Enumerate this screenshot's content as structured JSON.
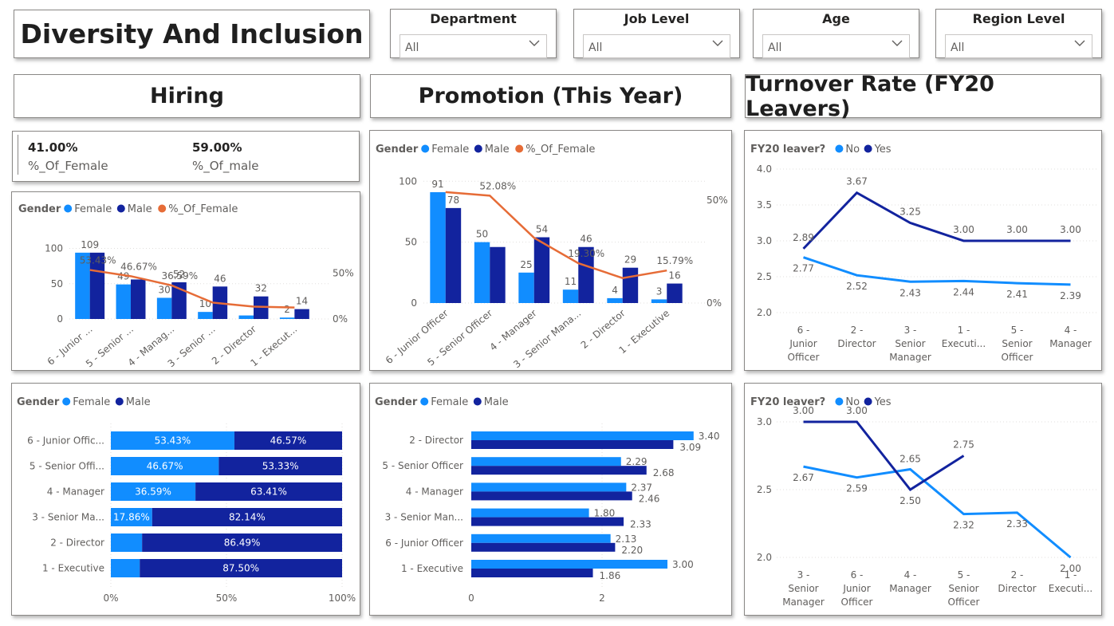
{
  "header": {
    "title": "Diversity And Inclusion"
  },
  "slicers": [
    {
      "label": "Department",
      "value": "All"
    },
    {
      "label": "Job Level",
      "value": "All"
    },
    {
      "label": "Age",
      "value": "All"
    },
    {
      "label": "Region Level",
      "value": "All"
    }
  ],
  "sections": {
    "hiring": "Hiring",
    "promotion": "Promotion (This Year)",
    "turnover": "Turnover Rate (FY20 Leavers)"
  },
  "kpi": {
    "female_value": "41.00%",
    "female_label": "%_Of_Female",
    "male_value": "59.00%",
    "male_label": "%_Of_male"
  },
  "colors": {
    "female": "#118dff",
    "male": "#12239e",
    "pct": "#e66c37",
    "border": "#8a8886"
  },
  "chart_data": [
    {
      "id": "hiring_combo",
      "type": "bar",
      "legend_title": "Gender",
      "series_names": [
        "Female",
        "Male",
        "%_Of_Female"
      ],
      "categories": [
        "6 - Junior ...",
        "5 - Senior ...",
        "4 - Manag...",
        "3 - Senior ...",
        "2 - Director",
        "1 - Execut..."
      ],
      "female": [
        94,
        49,
        30,
        10,
        5,
        2
      ],
      "male": [
        94,
        56,
        52,
        46,
        32,
        14
      ],
      "female_labels": [
        "",
        "49",
        "30",
        "10",
        "",
        "2"
      ],
      "male_labels": [
        "",
        "",
        "52",
        "46",
        "32",
        "14"
      ],
      "top_labels": [
        "109",
        "",
        "",
        "",
        "",
        ""
      ],
      "pct_of_female": [
        53.43,
        46.67,
        36.59,
        17.86,
        13.51,
        12.5
      ],
      "pct_labels": [
        "53.43%",
        "46.67%",
        "36.59%",
        "",
        "",
        ""
      ],
      "y_ticks": [
        "0",
        "50",
        "100"
      ],
      "y2_ticks": [
        "0%",
        "50%"
      ],
      "ylim": [
        0,
        130
      ],
      "y2lim": [
        0,
        100
      ]
    },
    {
      "id": "promotion_combo",
      "type": "bar",
      "legend_title": "Gender",
      "series_names": [
        "Female",
        "Male",
        "%_Of_Female"
      ],
      "categories": [
        "6 - Junior Officer",
        "5 - Senior Officer",
        "4 - Manager",
        "3 - Senior Mana...",
        "2 - Director",
        "1 - Executive"
      ],
      "female": [
        91,
        50,
        25,
        11,
        4,
        3
      ],
      "male": [
        78,
        46,
        54,
        46,
        29,
        16
      ],
      "female_labels": [
        "91",
        "50",
        "25",
        "11",
        "4",
        "3"
      ],
      "male_labels": [
        "78",
        "",
        "54",
        "46",
        "29",
        "16"
      ],
      "pct_of_female": [
        53.85,
        52.08,
        31.65,
        19.3,
        12.12,
        15.79
      ],
      "pct_labels": [
        "",
        "52.08%",
        "",
        "19.30%",
        "",
        "15.79%"
      ],
      "y_ticks": [
        "0",
        "50",
        "100"
      ],
      "y2_ticks": [
        "0%",
        "50%"
      ],
      "ylim": [
        0,
        110
      ],
      "y2lim": [
        0,
        65
      ]
    },
    {
      "id": "turnover_line_1",
      "type": "line",
      "legend_title": "FY20 leaver?",
      "series_names": [
        "No",
        "Yes"
      ],
      "categories": [
        [
          "6 -",
          "Junior",
          "Officer"
        ],
        [
          "2 -",
          "Director"
        ],
        [
          "3 -",
          "Senior",
          "Manager"
        ],
        [
          "1 -",
          "Executi..."
        ],
        [
          "5 -",
          "Senior",
          "Officer"
        ],
        [
          "4 -",
          "Manager"
        ]
      ],
      "no": [
        2.77,
        2.52,
        2.43,
        2.44,
        2.41,
        2.39
      ],
      "yes": [
        2.89,
        3.67,
        3.25,
        3.0,
        3.0,
        3.0
      ],
      "no_labels": [
        "2.77",
        "2.52",
        "2.43",
        "2.44",
        "2.41",
        "2.39"
      ],
      "yes_labels": [
        "2.89",
        "3.67",
        "3.25",
        "3.00",
        "3.00",
        "3.00"
      ],
      "y_ticks": [
        "2.0",
        "2.5",
        "3.0",
        "3.5",
        "4.0"
      ],
      "ylim": [
        2.0,
        4.0
      ]
    },
    {
      "id": "hiring_stacked",
      "type": "bar",
      "legend_title": "Gender",
      "series_names": [
        "Female",
        "Male"
      ],
      "categories": [
        "6 - Junior Offic...",
        "5 - Senior Offi...",
        "4 - Manager",
        "3 - Senior Ma...",
        "2 - Director",
        "1 - Executive"
      ],
      "female_pct": [
        53.43,
        46.67,
        36.59,
        17.86,
        13.51,
        12.5
      ],
      "male_pct": [
        46.57,
        53.33,
        63.41,
        82.14,
        86.49,
        87.5
      ],
      "female_labels": [
        "53.43%",
        "46.67%",
        "36.59%",
        "17.86%",
        "",
        ""
      ],
      "male_labels": [
        "46.57%",
        "53.33%",
        "63.41%",
        "82.14%",
        "86.49%",
        "87.50%"
      ],
      "x_ticks": [
        "0%",
        "50%",
        "100%"
      ]
    },
    {
      "id": "promotion_hbar",
      "type": "bar",
      "legend_title": "Gender",
      "series_names": [
        "Female",
        "Male"
      ],
      "categories": [
        "2 - Director",
        "5 - Senior Officer",
        "4 - Manager",
        "3 - Senior Man...",
        "6 - Junior Officer",
        "1 - Executive"
      ],
      "female": [
        3.4,
        2.29,
        2.37,
        1.8,
        2.13,
        3.0
      ],
      "male": [
        3.09,
        2.68,
        2.46,
        2.33,
        2.2,
        1.86
      ],
      "female_labels": [
        "3.40",
        "2.29",
        "2.37",
        "1.80",
        "2.13",
        "3.00"
      ],
      "male_labels": [
        "3.09",
        "2.68",
        "2.46",
        "2.33",
        "2.20",
        "1.86"
      ],
      "x_ticks": [
        "0",
        "2"
      ]
    },
    {
      "id": "turnover_line_2",
      "type": "line",
      "legend_title": "FY20 leaver?",
      "series_names": [
        "No",
        "Yes"
      ],
      "categories": [
        [
          "3 -",
          "Senior",
          "Manager"
        ],
        [
          "6 -",
          "Junior",
          "Officer"
        ],
        [
          "4 -",
          "Manager"
        ],
        [
          "5 -",
          "Senior",
          "Officer"
        ],
        [
          "2 -",
          "Director"
        ],
        [
          "1 -",
          "Executi..."
        ]
      ],
      "no": [
        2.67,
        2.59,
        2.65,
        2.32,
        2.33,
        2.0
      ],
      "yes": [
        3.0,
        3.0,
        2.5,
        2.75,
        null,
        null
      ],
      "no_labels": [
        "2.67",
        "2.59",
        "2.65",
        "2.32",
        "2.33",
        "2.00"
      ],
      "yes_labels": [
        "3.00",
        "3.00",
        "2.50",
        "2.75",
        "",
        ""
      ],
      "y_ticks": [
        "2.0",
        "2.5",
        "3.0"
      ],
      "ylim": [
        2.0,
        3.0
      ]
    }
  ]
}
